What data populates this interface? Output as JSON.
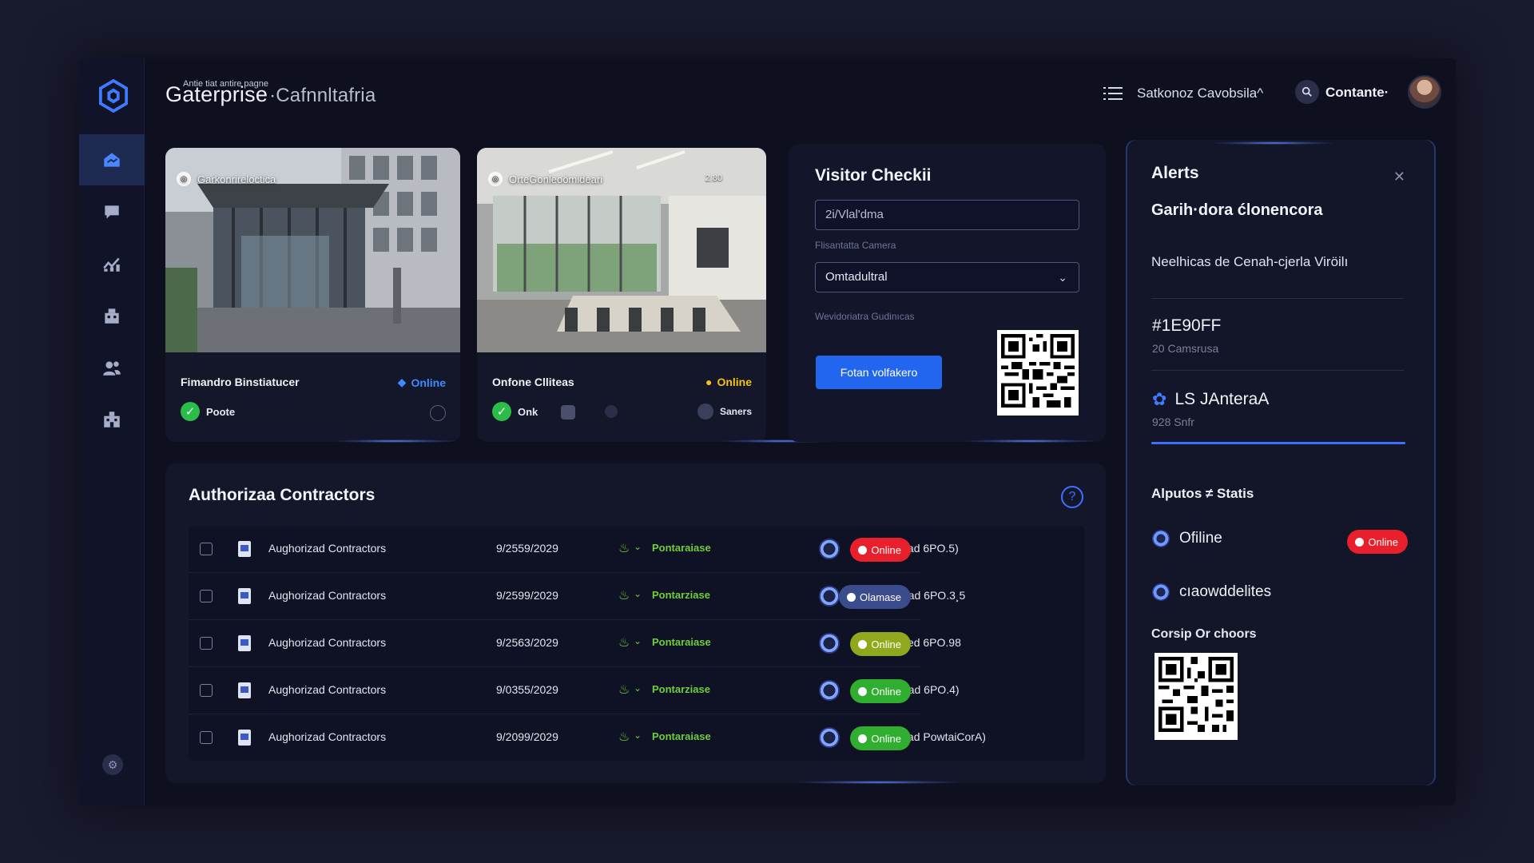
{
  "brand": {
    "subtitle": "Antie tiat antire pagne",
    "name_main": "Gaterprise",
    "name_rest": "·Cafnnltafria"
  },
  "header": {
    "org_selector": "Satkonoz Cavobsila^",
    "contact_label": "Contante·"
  },
  "sidebar": {
    "items": [
      {
        "icon": "home-icon",
        "active": true
      },
      {
        "icon": "chat-icon",
        "active": false
      },
      {
        "icon": "analytics-icon",
        "active": false
      },
      {
        "icon": "building-icon",
        "active": false
      },
      {
        "icon": "users-icon",
        "active": false
      },
      {
        "icon": "facility-icon",
        "active": false
      }
    ]
  },
  "cameras": [
    {
      "overlay_label": "Garkonrireloctica",
      "title": "Fimandro Binstiatucer",
      "status": "Online",
      "status_color": "#3d8bff",
      "check_label": "Poote"
    },
    {
      "overlay_label": "OrteGonleoömideari",
      "overlay_extra": "2.80",
      "title": "Onfone Clliteas",
      "status": "Online",
      "status_color": "#f4c21e",
      "check_label": "Onk",
      "extra_label": "Saners"
    }
  ],
  "visitor_checkin": {
    "title": "Visitor Checkii",
    "input_value": "2i/Vlal'dma",
    "camera_label": "Flisantatta Camera",
    "select_value": "Omtadultral",
    "guidance_label": "Wevidoriatra Gudinıcas",
    "button_label": "Fotan volfakero"
  },
  "contractors": {
    "title": "Authorizaa Contractors",
    "help_icon": "help-icon",
    "rows": [
      {
        "name": "Aughorizad Contractors",
        "date": "9/2559/2029",
        "tag": "Pontaraiase",
        "person": "Authorioazad 6PO.5)",
        "status": "Online",
        "status_color": "#e8202b"
      },
      {
        "name": "Aughorizad Contractors",
        "date": "9/2599/2029",
        "tag": "Pontarziase",
        "person": "Cepthobazad 6PO.3¸5",
        "status": "Olamase",
        "status_color": "#3a4c8c"
      },
      {
        "name": "Aughorizad Contractors",
        "date": "9/2563/2029",
        "tag": "Pontaraiase",
        "person": "Authorioased 6PO.98",
        "status": "Online",
        "status_color": "#8fa81c"
      },
      {
        "name": "Aughorizad Contractors",
        "date": "9/0355/2029",
        "tag": "Pontarziase",
        "person": "Cepthobazad 6PO.4)",
        "status": "Online",
        "status_color": "#2fae2f"
      },
      {
        "name": "Aughorizad Contractors",
        "date": "9/2099/2029",
        "tag": "Pontaraiase",
        "person": "Authorioazad PowtaiCorA)",
        "status": "Online",
        "status_color": "#2fae2f"
      }
    ]
  },
  "alerts": {
    "title": "Alerts",
    "headline": "Garih·dora ćlonencora",
    "description": "Neelhicas de Cenah-cjerla Viröilı",
    "items": [
      {
        "title": "#1E90FF",
        "sub": "20 Camsrusa"
      },
      {
        "title": "LS JAnteraA",
        "sub": "928 Snfr"
      }
    ],
    "status_title": "Alputos ≠ Statis",
    "status_rows": [
      {
        "label": "Ofiline",
        "badge": "Online",
        "badge_color": "#e8202b"
      },
      {
        "label": "cıaowddelites"
      }
    ],
    "qr_label": "Corsip Or choors"
  },
  "colors": {
    "accent": "#2266f0",
    "background": "#0e1020",
    "panel": "#141629"
  }
}
